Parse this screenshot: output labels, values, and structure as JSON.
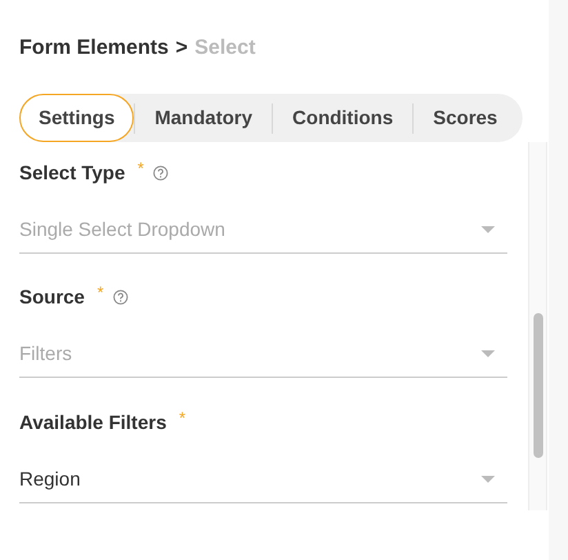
{
  "breadcrumb": {
    "parent": "Form Elements",
    "separator": ">",
    "current": "Select"
  },
  "tabs": [
    {
      "label": "Settings",
      "selected": true
    },
    {
      "label": "Mandatory",
      "selected": false
    },
    {
      "label": "Conditions",
      "selected": false
    },
    {
      "label": "Scores",
      "selected": false
    }
  ],
  "fields": [
    {
      "label": "Select Type",
      "required_mark": "*",
      "help": true,
      "placeholder": "Single Select Dropdown"
    },
    {
      "label": "Source",
      "required_mark": "*",
      "help": true,
      "placeholder": "Filters"
    },
    {
      "label": "Available Filters",
      "required_mark": "*",
      "help": false,
      "value": "Region"
    }
  ]
}
